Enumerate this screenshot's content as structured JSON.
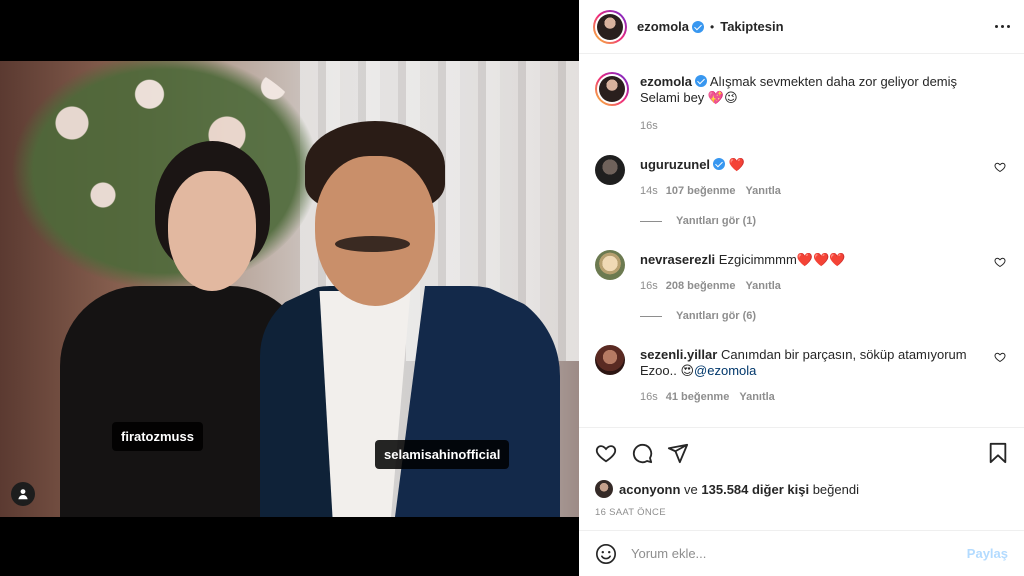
{
  "post": {
    "author": "ezomola",
    "follow_status": "Takiptesin",
    "photo_tags": [
      "firatozmuss",
      "selamisahinofficial"
    ],
    "caption": "Alışmak sevmekten daha zor geliyor demiş Selami bey 💖😉",
    "caption_time": "16s"
  },
  "comments": [
    {
      "user": "uguruzunel",
      "verified": true,
      "text": "❤️",
      "time": "14s",
      "likes": "107 beğenme",
      "reply_label": "Yanıtla",
      "view_replies": "Yanıtları gör (1)"
    },
    {
      "user": "nevraserezli",
      "verified": false,
      "text": "Ezgicimmmm❤️❤️❤️",
      "time": "16s",
      "likes": "208 beğenme",
      "reply_label": "Yanıtla",
      "view_replies": "Yanıtları gör (6)"
    },
    {
      "user": "sezenli.yillar",
      "verified": false,
      "text": "Canımdan bir parçasın, söküp atamıyorum Ezoo.. 😍",
      "mention": "@ezomola",
      "time": "16s",
      "likes": "41 beğenme",
      "reply_label": "Yanıtla"
    }
  ],
  "likes": {
    "user": "aconyonn",
    "connector": "ve",
    "count_text": "135.584 diğer kişi",
    "suffix": "beğendi"
  },
  "timestamp": "16 SAAT ÖNCE",
  "composer": {
    "placeholder": "Yorum ekle...",
    "post_label": "Paylaş"
  },
  "icons": [
    "user-tag-icon",
    "more-options-icon",
    "heart-icon",
    "comment-icon",
    "share-icon",
    "bookmark-icon",
    "emoji-icon",
    "verified-badge-icon"
  ],
  "colors": {
    "verified": "#3897f0",
    "post_disabled": "#b3dbff",
    "mention": "#00376b",
    "secondary_text": "#8e8e8e"
  }
}
